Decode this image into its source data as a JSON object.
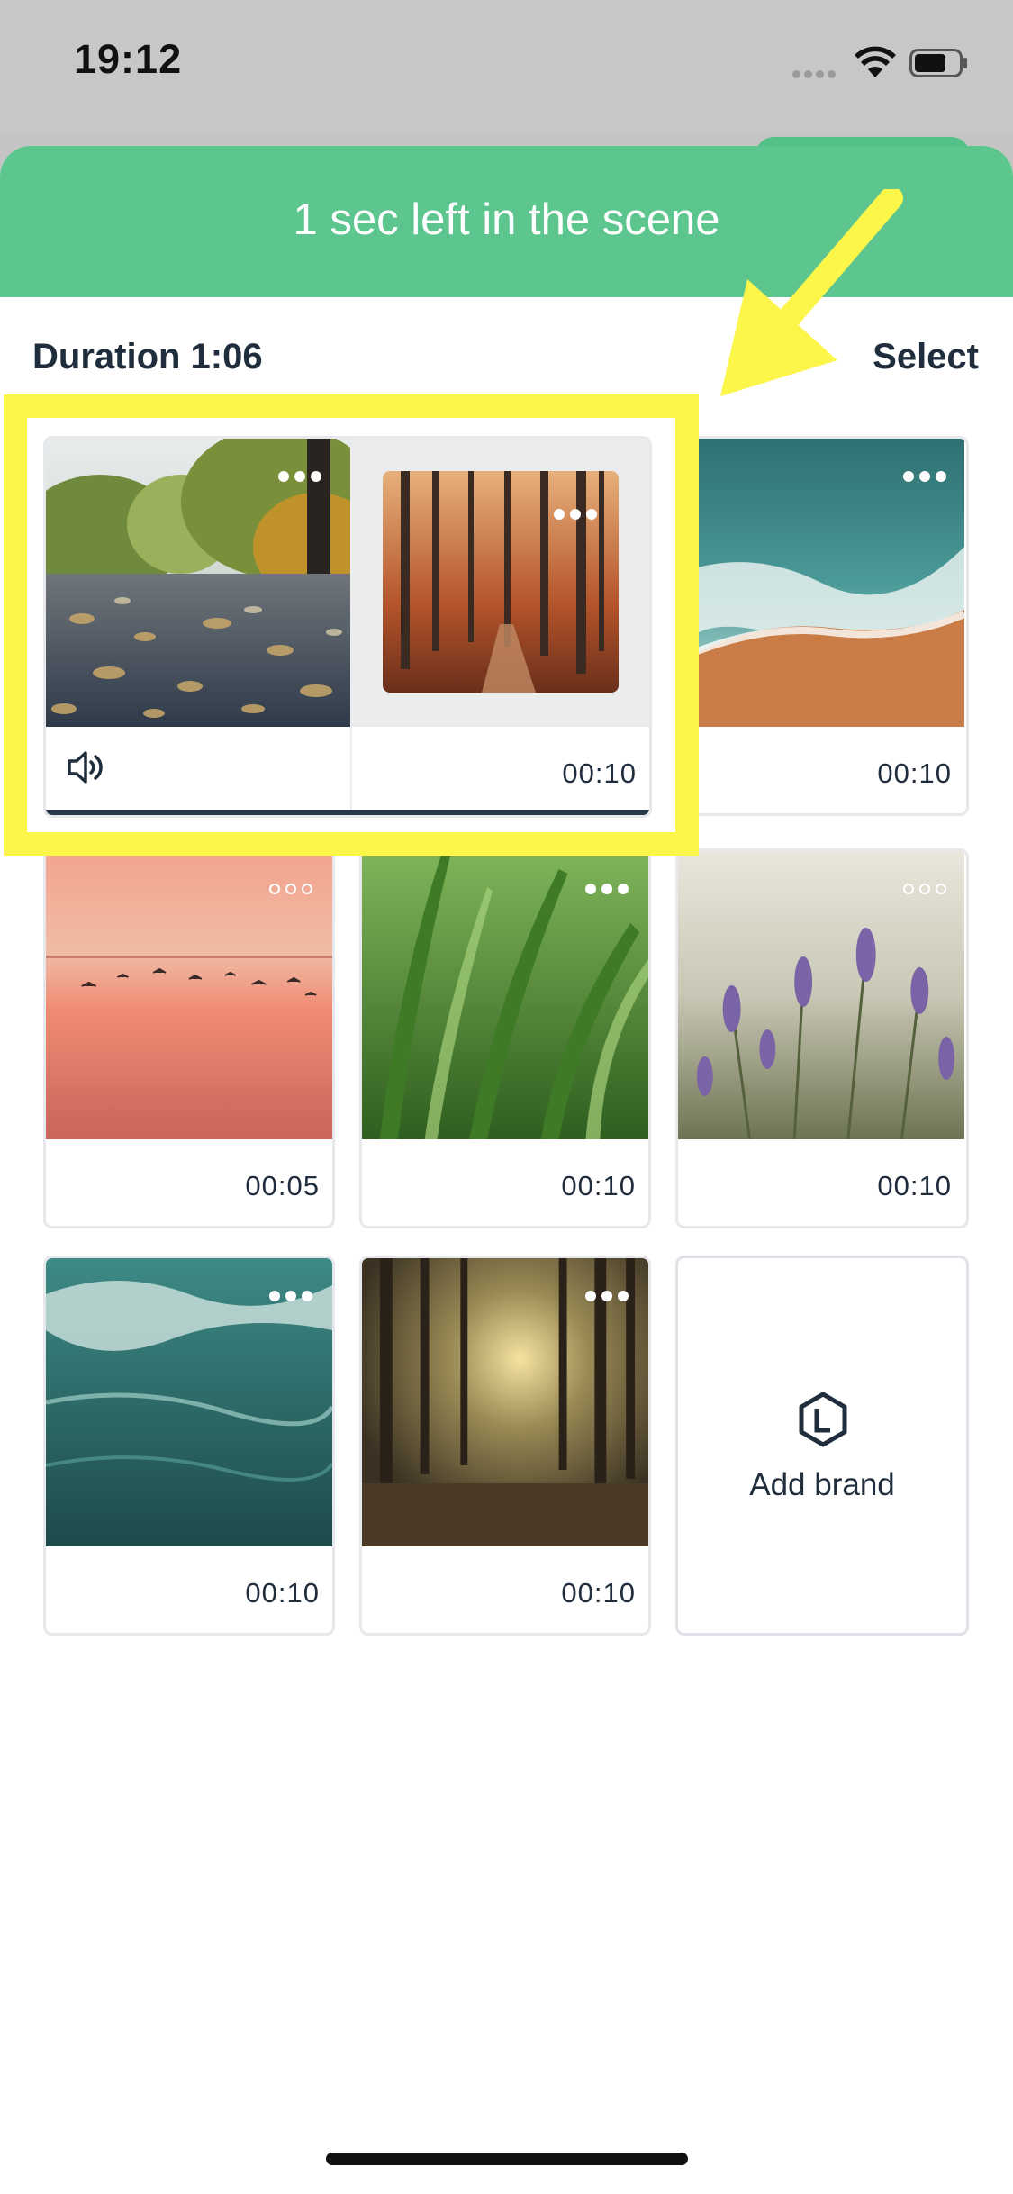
{
  "status_bar": {
    "time": "19:12"
  },
  "banner": {
    "text": "1 sec left in the scene"
  },
  "header": {
    "duration": "Duration 1:06",
    "select": "Select"
  },
  "selected_scene": {
    "duration": "00:10"
  },
  "clips": [
    {
      "name": "ocean-waves-clip",
      "duration": "00:10"
    },
    {
      "name": "sunset-birds-clip",
      "duration": "00:05"
    },
    {
      "name": "grass-clip",
      "duration": "00:10"
    },
    {
      "name": "lavender-clip",
      "duration": "00:10"
    },
    {
      "name": "teal-water-clip",
      "duration": "00:10"
    },
    {
      "name": "forest-sunlight-clip",
      "duration": "00:10"
    }
  ],
  "add_brand": {
    "label": "Add brand"
  },
  "colors": {
    "banner": "#5dc68f",
    "highlight": "#fdf64a",
    "text": "#1f2d3d"
  }
}
